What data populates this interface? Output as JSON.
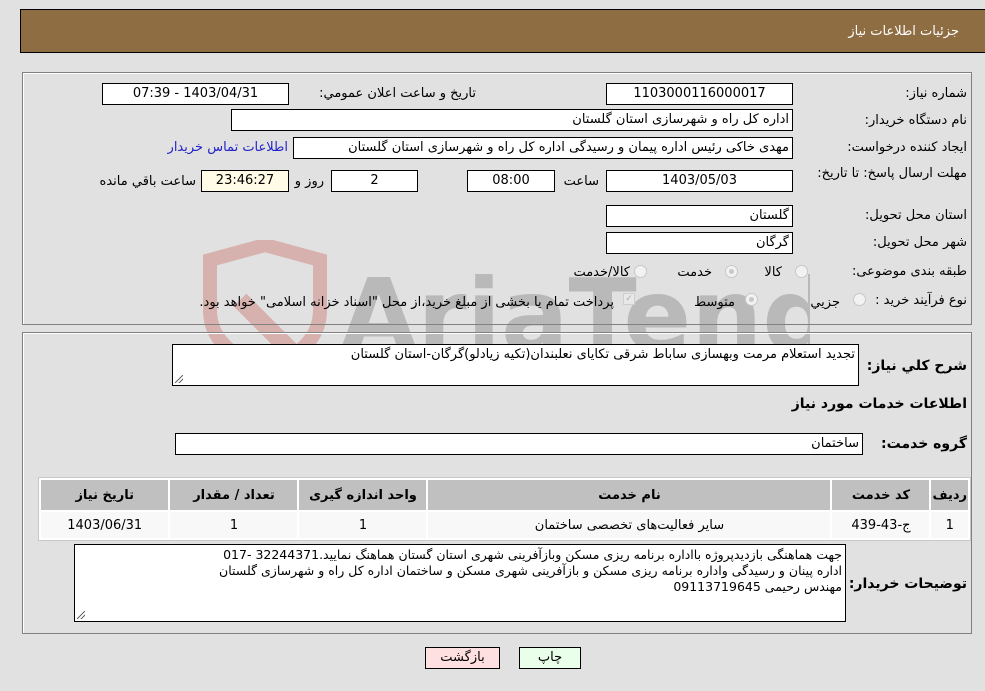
{
  "header": {
    "title": "جزئیات اطلاعات نیاز"
  },
  "form": {
    "need_number_label": "شماره نیاز:",
    "need_number": "1103000116000017",
    "announce_label": "تاریخ و ساعت اعلان عمومي:",
    "announce_value": "1403/04/31 - 07:39",
    "buyer_org_label": "نام دستگاه خريدار:",
    "buyer_org": "اداره کل راه و شهرسازی استان گلستان",
    "creator_label": "ایجاد کننده درخواست:",
    "creator": "مهدی خاکی رئیس اداره پیمان و رسیدگی اداره کل راه و شهرسازی استان گلستان",
    "contact_link": "اطلاعات تماس خريدار",
    "deadline_label": "مهلت ارسال پاسخ: تا تاریخ:",
    "deadline_date": "1403/05/03",
    "time_label": "ساعت",
    "deadline_time": "08:00",
    "days_value": "2",
    "days_label": "روز و",
    "remaining_time": "23:46:27",
    "remaining_label": "ساعت باقي مانده",
    "province_label": "استان محل تحویل:",
    "province": "گلستان",
    "city_label": "شهر محل تحویل:",
    "city": "گرگان",
    "category_label": "طبقه بندی موضوعی:",
    "category_options": [
      "کالا",
      "خدمت",
      "کالا/خدمت"
    ],
    "category_selected": "خدمت",
    "purchase_type_label": "نوع فرآیند خرید :",
    "purchase_type_options": [
      "جزيي",
      "متوسط"
    ],
    "purchase_type_selected": "متوسط",
    "treasury_note": "پرداخت تمام یا بخشی از مبلغ خرید،از محل \"اسناد خزانه اسلامی\" خواهد بود."
  },
  "details": {
    "summary_label": "شرح کلي نياز:",
    "summary": "تجدید استعلام مرمت وبهسازی ساباط شرقی تکایای نعلبندان(تکیه زیادلو)گرگان-استان گلستان",
    "services_heading": "اطلاعات خدمات مورد نیاز",
    "service_group_label": "گروه خدمت:",
    "service_group": "ساختمان",
    "table": {
      "headers": [
        "رديف",
        "کد خدمت",
        "نام خدمت",
        "واحد اندازه گيری",
        "تعداد / مقدار",
        "تاريخ نياز"
      ],
      "rows": [
        [
          "1",
          "ج-43-439",
          "سایر فعالیت‌های تخصصی ساختمان",
          "1",
          "1",
          "1403/06/31"
        ]
      ]
    },
    "buyer_notes_label": "توضیحات خریدار:",
    "buyer_notes_lines": [
      "جهت هماهنگی بازدیدپروژه بااداره برنامه ریزی مسکن وبازآفرینی شهری استان گستان هماهنگ نمایید.32244371 -017",
      "اداره پینان و رسیدگی واداره برنامه ریزی مسکن و بازآفرینی شهری مسکن و ساختمان اداره کل راه و شهرسازی گلستان",
      "مهندس رحیمی 09113719645"
    ]
  },
  "buttons": {
    "print": "چاپ",
    "back": "بازگشت"
  },
  "watermark": {
    "text": "AriaTender.neT"
  }
}
